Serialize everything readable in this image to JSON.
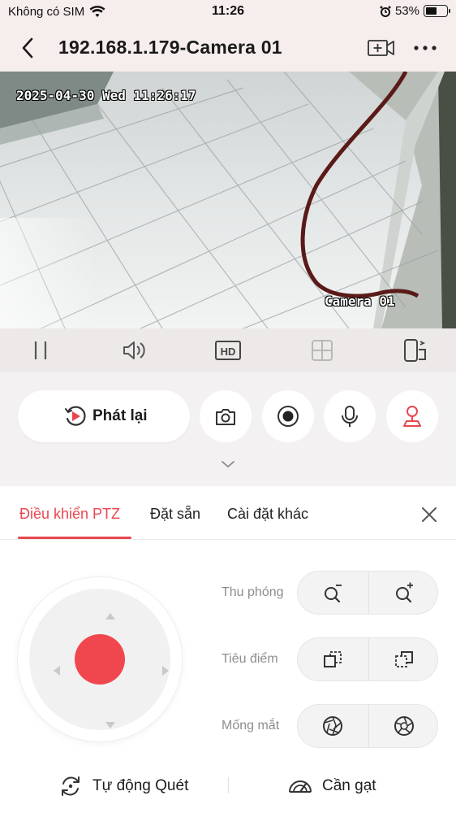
{
  "status_bar": {
    "carrier": "Không có SIM",
    "time": "11:26",
    "battery": "53%",
    "battery_level": 0.53
  },
  "header": {
    "title": "192.168.1.179-Camera 01"
  },
  "video": {
    "timestamp": "2025-04-30 Wed 11:26:17",
    "camera_label": "Camera 01"
  },
  "controls": {
    "items": [
      "pause-icon",
      "speaker-icon",
      "hd-icon",
      "grid-icon",
      "rotate-screen-icon"
    ],
    "hd_label": "HD"
  },
  "actions": {
    "playback_label": "Phát lại"
  },
  "tabs": [
    {
      "label": "Điều khiển PTZ",
      "active": true
    },
    {
      "label": "Đặt sẵn",
      "active": false
    },
    {
      "label": "Cài đặt khác",
      "active": false
    }
  ],
  "ptz": {
    "zoom_label": "Thu phóng",
    "focus_label": "Tiêu điểm",
    "iris_label": "Mống mắt",
    "auto_scan_label": "Tự động Quét",
    "wiper_label": "Cần gạt"
  },
  "colors": {
    "accent": "#e8474f",
    "header_bg": "#f6eeed",
    "control_bar_bg": "#ede9e9"
  }
}
